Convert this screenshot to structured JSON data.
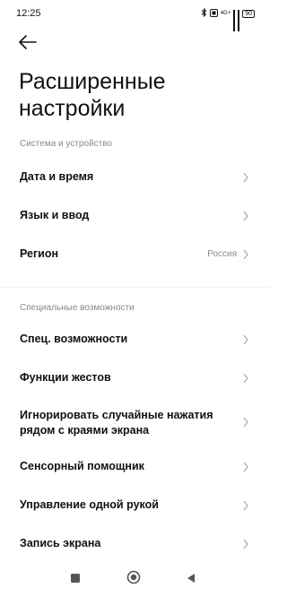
{
  "status_bar": {
    "time": "12:25",
    "network": "4G+",
    "battery": "90"
  },
  "header": {
    "title": "Расширенные настройки"
  },
  "sections": [
    {
      "title": "Система и устройство",
      "items": [
        {
          "label": "Дата и время",
          "value": ""
        },
        {
          "label": "Язык и ввод",
          "value": ""
        },
        {
          "label": "Регион",
          "value": "Россия"
        }
      ]
    },
    {
      "title": "Специальные возможности",
      "items": [
        {
          "label": "Спец. возможности",
          "value": ""
        },
        {
          "label": "Функции жестов",
          "value": ""
        },
        {
          "label": "Игнорировать случайные нажатия рядом с краями экрана",
          "value": ""
        },
        {
          "label": "Сенсорный помощник",
          "value": ""
        },
        {
          "label": "Управление одной рукой",
          "value": ""
        },
        {
          "label": "Запись экрана",
          "value": ""
        }
      ]
    }
  ],
  "icons": {
    "back": "arrow-left-icon",
    "chevron": "chevron-right-icon",
    "nav_recents": "square-icon",
    "nav_home": "circle-icon",
    "nav_back": "triangle-left-icon"
  },
  "colors": {
    "background": "#ffffff",
    "text_primary": "#111111",
    "text_secondary": "#8a8a8a",
    "chevron": "#b0b0b0"
  }
}
